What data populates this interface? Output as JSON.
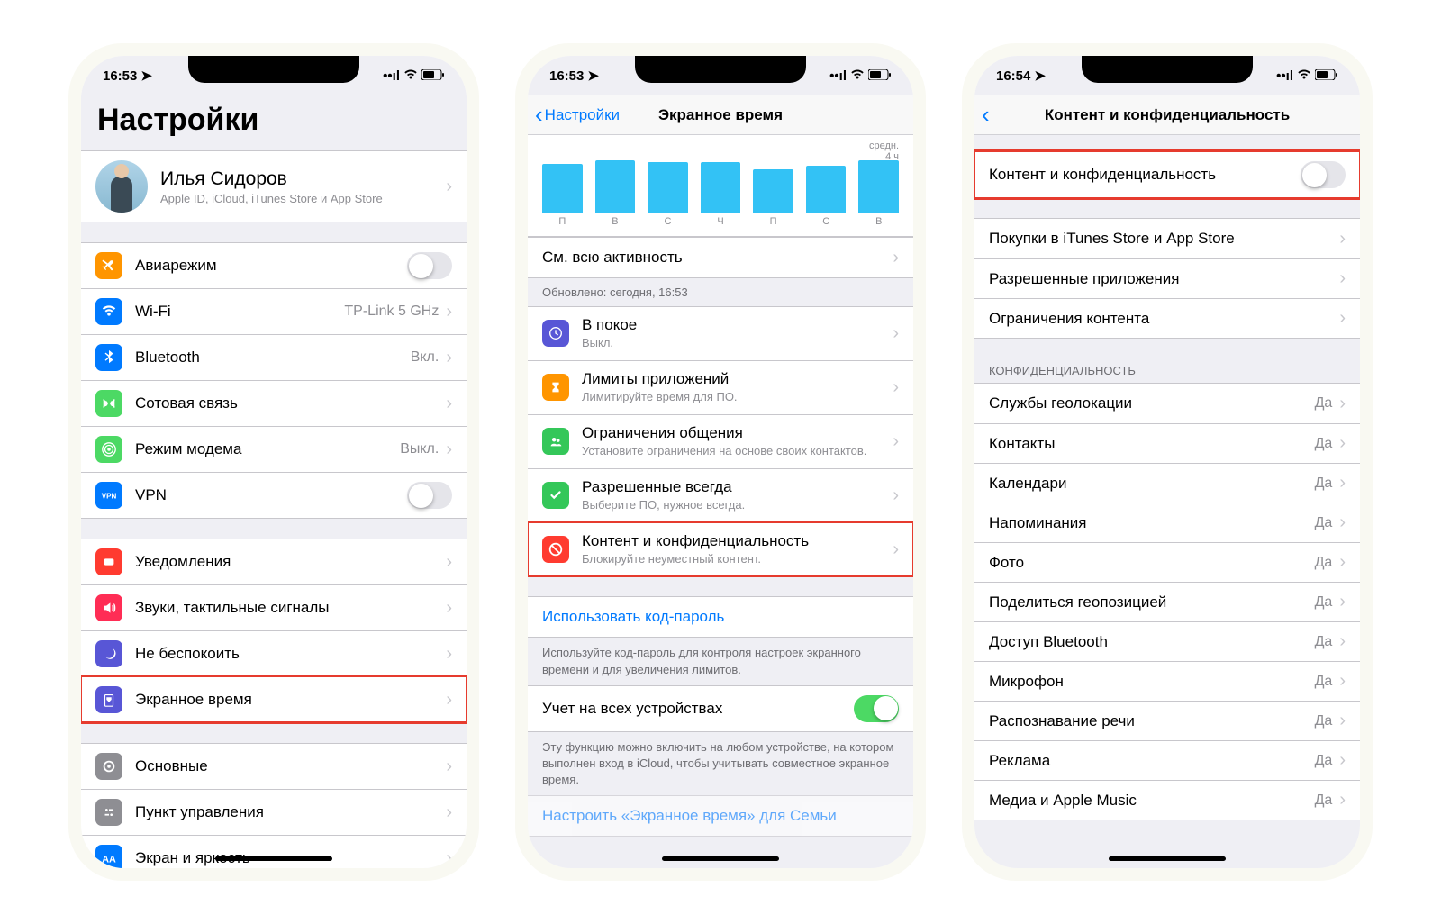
{
  "phone1": {
    "time": "16:53",
    "title": "Настройки",
    "profile": {
      "name": "Илья Сидоров",
      "sub": "Apple ID, iCloud, iTunes Store и App Store"
    },
    "g1": [
      {
        "icon": "airplane",
        "color": "#ff9500",
        "label": "Авиарежим",
        "toggle": false
      },
      {
        "icon": "wifi",
        "color": "#007aff",
        "label": "Wi-Fi",
        "value": "TP-Link 5 GHz"
      },
      {
        "icon": "bluetooth",
        "color": "#007aff",
        "label": "Bluetooth",
        "value": "Вкл."
      },
      {
        "icon": "cellular",
        "color": "#4cd964",
        "label": "Сотовая связь",
        "value": ""
      },
      {
        "icon": "hotspot",
        "color": "#4cd964",
        "label": "Режим модема",
        "value": "Выкл."
      },
      {
        "icon": "vpn",
        "color": "#007aff",
        "label": "VPN",
        "toggle": false
      }
    ],
    "g2": [
      {
        "icon": "notifications",
        "color": "#ff3b30",
        "label": "Уведомления"
      },
      {
        "icon": "sounds",
        "color": "#ff2d55",
        "label": "Звуки, тактильные сигналы"
      },
      {
        "icon": "dnd",
        "color": "#5856d6",
        "label": "Не беспокоить"
      },
      {
        "icon": "screentime",
        "color": "#5856d6",
        "label": "Экранное время",
        "highlight": true
      }
    ],
    "g3": [
      {
        "icon": "general",
        "color": "#8e8e93",
        "label": "Основные"
      },
      {
        "icon": "control",
        "color": "#8e8e93",
        "label": "Пункт управления"
      },
      {
        "icon": "display",
        "color": "#007aff",
        "label": "Экран и яркость"
      }
    ]
  },
  "phone2": {
    "time": "16:53",
    "back": "Настройки",
    "title": "Экранное время",
    "chart": {
      "avg_label": "средн.",
      "avg_hours": "4 ч",
      "days": [
        "П",
        "В",
        "С",
        "Ч",
        "П",
        "С",
        "В"
      ],
      "heights": [
        68,
        72,
        70,
        70,
        60,
        65,
        72
      ]
    },
    "see_all": "См. всю активность",
    "updated": "Обновлено: сегодня, 16:53",
    "items": [
      {
        "icon": "downtime",
        "color": "#5856d6",
        "label": "В покое",
        "sub": "Выкл."
      },
      {
        "icon": "applimits",
        "color": "#ff9500",
        "label": "Лимиты приложений",
        "sub": "Лимитируйте время для ПО."
      },
      {
        "icon": "commlimits",
        "color": "#34c759",
        "label": "Ограничения общения",
        "sub": "Установите ограничения на основе своих контактов."
      },
      {
        "icon": "allowed",
        "color": "#34c759",
        "label": "Разрешенные всегда",
        "sub": "Выберите ПО, нужное всегда."
      },
      {
        "icon": "content",
        "color": "#ff3b30",
        "label": "Контент и конфиденциальность",
        "sub": "Блокируйте неуместный контент.",
        "highlight": true
      }
    ],
    "passcode": "Использовать код-пароль",
    "passcode_foot": "Используйте код-пароль для контроля настроек экранного времени и для увеличения лимитов.",
    "share": "Учет на всех устройствах",
    "share_foot": "Эту функцию можно включить на любом устройстве, на котором выполнен вход в iCloud, чтобы учитывать совместное экранное время.",
    "family": "Настроить «Экранное время» для Семьи"
  },
  "phone3": {
    "time": "16:54",
    "title": "Контент и конфиденциальность",
    "main_toggle": "Контент и конфиденциальность",
    "g1": [
      {
        "label": "Покупки в iTunes Store и App Store"
      },
      {
        "label": "Разрешенные приложения"
      },
      {
        "label": "Ограничения контента"
      }
    ],
    "privacy_header": "КОНФИДЕНЦИАЛЬНОСТЬ",
    "privacy": [
      {
        "label": "Службы геолокации",
        "value": "Да"
      },
      {
        "label": "Контакты",
        "value": "Да"
      },
      {
        "label": "Календари",
        "value": "Да"
      },
      {
        "label": "Напоминания",
        "value": "Да"
      },
      {
        "label": "Фото",
        "value": "Да"
      },
      {
        "label": "Поделиться геопозицией",
        "value": "Да"
      },
      {
        "label": "Доступ Bluetooth",
        "value": "Да"
      },
      {
        "label": "Микрофон",
        "value": "Да"
      },
      {
        "label": "Распознавание речи",
        "value": "Да"
      },
      {
        "label": "Реклама",
        "value": "Да"
      },
      {
        "label": "Медиа и Apple Music",
        "value": "Да"
      }
    ]
  },
  "chart_data": {
    "type": "bar",
    "categories": [
      "П",
      "В",
      "С",
      "Ч",
      "П",
      "С",
      "В"
    ],
    "values": [
      4.0,
      4.3,
      4.1,
      4.1,
      3.6,
      3.9,
      4.3
    ],
    "title": "Экранное время",
    "ylabel": "ч",
    "ylim": [
      0,
      5
    ],
    "average_label": "средн.",
    "average_value": 4
  }
}
